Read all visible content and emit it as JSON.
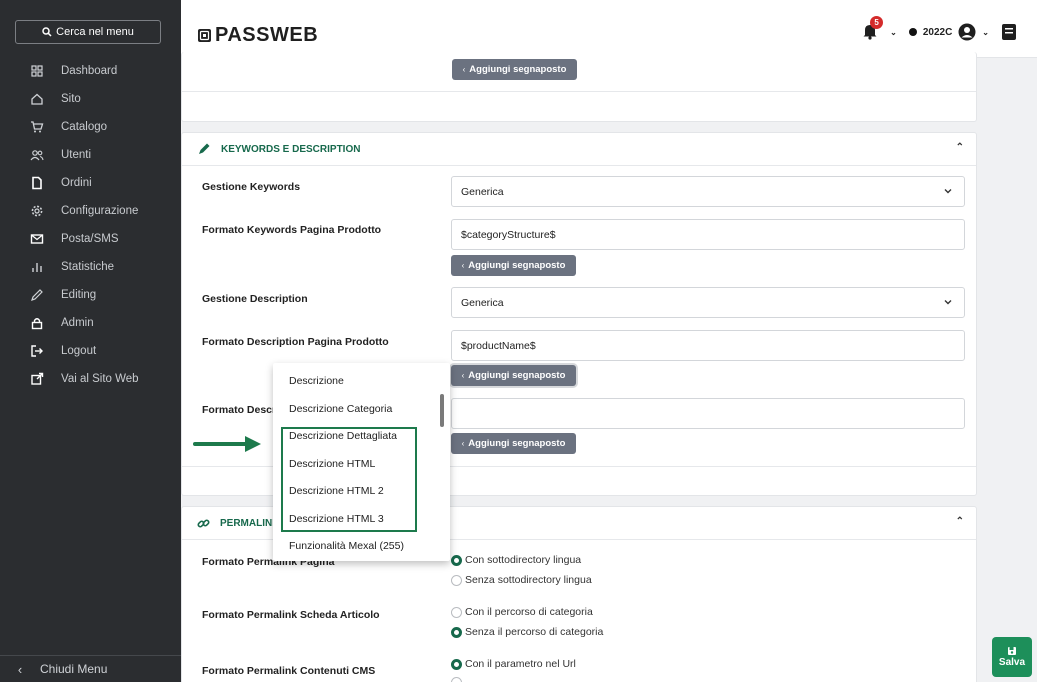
{
  "sidebar": {
    "search_label": "Cerca nel menu",
    "items": [
      {
        "label": "Dashboard",
        "icon": "dashboard-icon"
      },
      {
        "label": "Sito",
        "icon": "home-icon"
      },
      {
        "label": "Catalogo",
        "icon": "cart-icon"
      },
      {
        "label": "Utenti",
        "icon": "users-icon"
      },
      {
        "label": "Ordini",
        "icon": "document-icon"
      },
      {
        "label": "Configurazione",
        "icon": "gear-icon"
      },
      {
        "label": "Posta/SMS",
        "icon": "mail-icon"
      },
      {
        "label": "Statistiche",
        "icon": "stats-icon"
      },
      {
        "label": "Editing",
        "icon": "pencil-icon"
      },
      {
        "label": "Admin",
        "icon": "lock-icon"
      },
      {
        "label": "Logout",
        "icon": "logout-icon"
      },
      {
        "label": "Vai al Sito Web",
        "icon": "external-link-icon"
      }
    ],
    "close_label": "Chiudi Menu"
  },
  "topbar": {
    "logo": "PASSWEB",
    "notifications": "5",
    "year": "2022C"
  },
  "buttons": {
    "add_placeholder": "Aggiungi segnaposto"
  },
  "keywords_section": {
    "title": "KEYWORDS E DESCRIPTION",
    "gestione_keywords_label": "Gestione Keywords",
    "gestione_keywords_value": "Generica",
    "formato_keywords_label": "Formato Keywords Pagina Prodotto",
    "formato_keywords_value": "$categoryStructure$",
    "gestione_description_label": "Gestione Description",
    "gestione_description_value": "Generica",
    "formato_description_label": "Formato Description Pagina Prodotto",
    "formato_description_value": "$productName$",
    "formato_descr_cat_label": "Formato Descri",
    "formato_descr_cat_value": ""
  },
  "dropdown": {
    "items": [
      "Descrizione",
      "Descrizione Categoria",
      "Descrizione Dettagliata",
      "Descrizione HTML",
      "Descrizione HTML 2",
      "Descrizione HTML 3",
      "Funzionalità Mexal (255)"
    ]
  },
  "permalink_section": {
    "title": "PERMALINK",
    "pagina_label": "Formato Permalink Pagina",
    "pagina_options": [
      "Con sottodirectory lingua",
      "Senza sottodirectory lingua"
    ],
    "scheda_label": "Formato Permalink Scheda Articolo",
    "scheda_options": [
      "Con il percorso di categoria",
      "Senza il percorso di categoria"
    ],
    "cms_label": "Formato Permalink Contenuti CMS",
    "cms_options": [
      "Con il parametro nel Url"
    ]
  },
  "save_label": "Salva",
  "colors": {
    "accent": "#17694c",
    "sidebar": "#2b2d30",
    "save": "#1d8f5a"
  }
}
